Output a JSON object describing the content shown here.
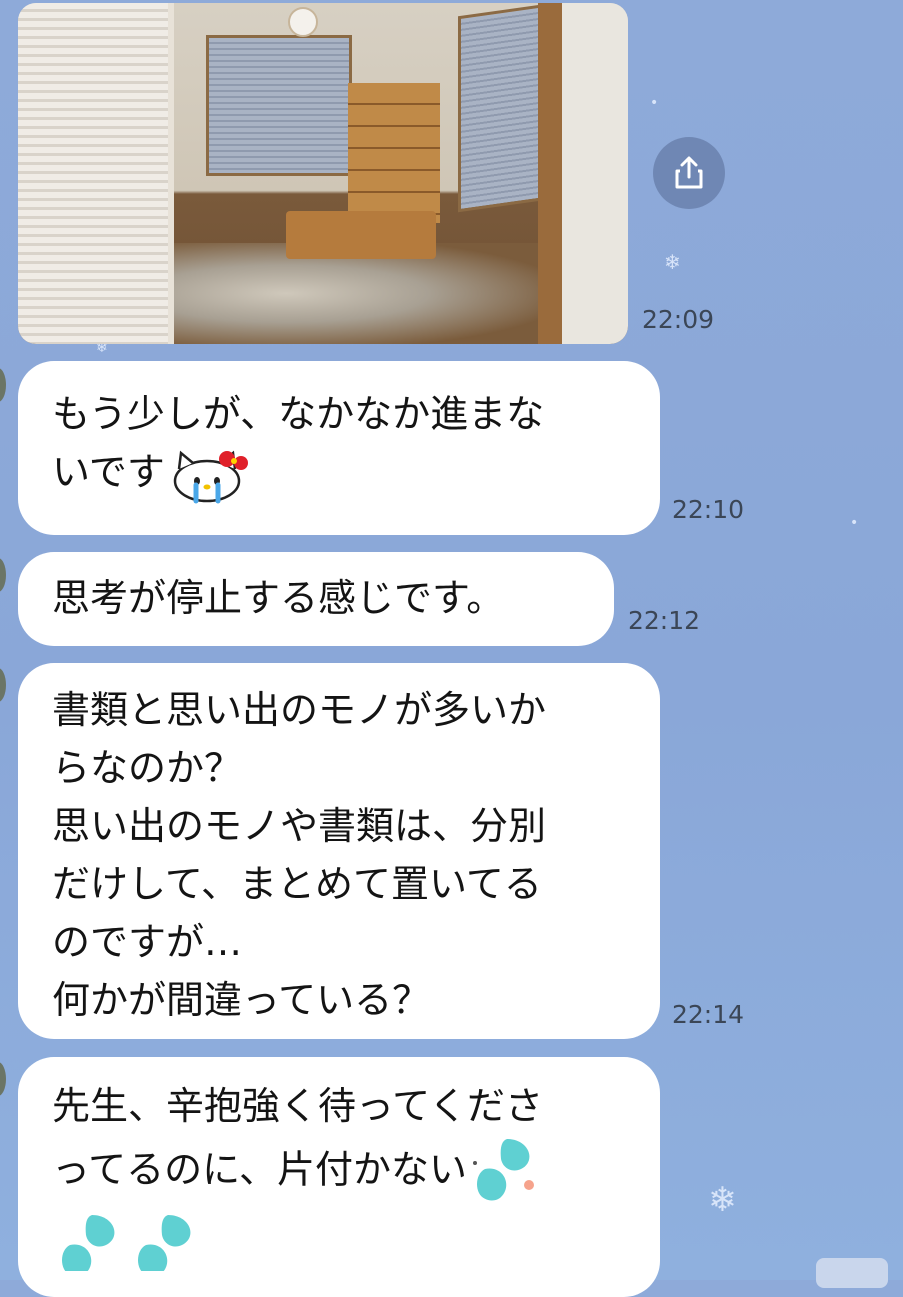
{
  "chat": {
    "messages": [
      {
        "type": "image",
        "time": "22:09",
        "alt": ""
      },
      {
        "type": "text",
        "lines": [
          "もう少しが、なかなか進まな",
          "いです"
        ],
        "sticker": "hello-kitty-crying-icon",
        "time": "22:10"
      },
      {
        "type": "text",
        "lines": [
          "思考が停止する感じです。"
        ],
        "time": "22:12"
      },
      {
        "type": "text",
        "lines": [
          "書類と思い出のモノが多いか",
          "らなのか？",
          "思い出のモノや書類は、分別",
          "だけして、まとめて置いてる",
          "のですが…",
          "何かが間違っている？"
        ],
        "time": "22:14"
      },
      {
        "type": "text",
        "lines": [
          "先生、辛抱強く待ってくださ",
          "ってるのに、片付かない"
        ],
        "sticker": "teardrop-emoji-icon",
        "time": ""
      }
    ]
  },
  "icons": {
    "share": "share-icon",
    "snowflake": "snowflake-icon"
  },
  "colors": {
    "background": "#8eaad9",
    "bubble": "#ffffff",
    "timestamp": "#3b4656",
    "share_button": "#6f87b4"
  }
}
